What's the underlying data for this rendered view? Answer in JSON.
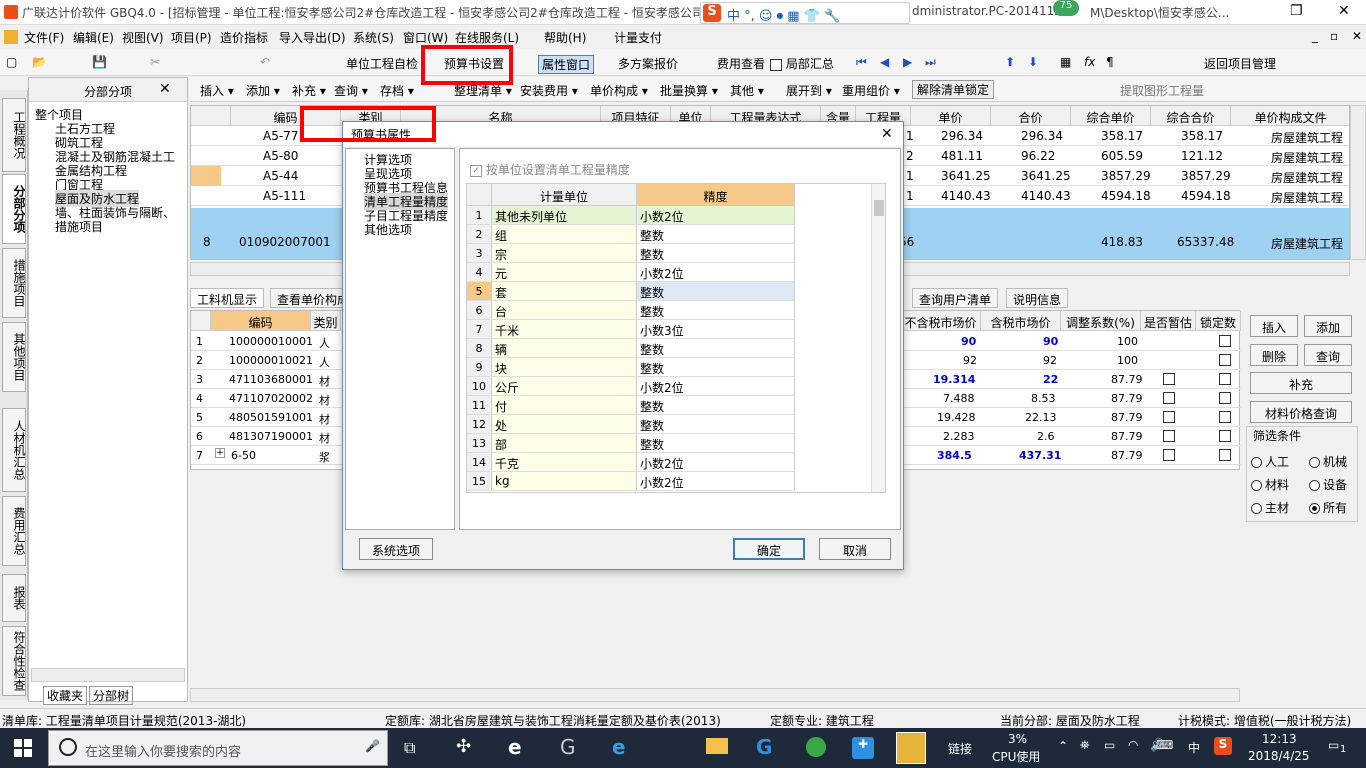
{
  "app": {
    "title": "广联达计价软件 GBQ4.0 - [招标管理 - 单位工程:恒安孝感公司2#仓库改造工程 - 恒安孝感公司2#仓库改造工程 - 恒安孝感公司2",
    "title_right": "dministrator.PC-2014112",
    "title_path": "M\\Desktop\\恒安孝感公...",
    "badge": "75",
    "ime_label": "中 °, ☺ ⏺ ▦ 👕 🔧"
  },
  "menu": [
    "文件(F)",
    "编辑(E)",
    "视图(V)",
    "项目(P)",
    "造价指标",
    "导入导出(D)",
    "系统(S)",
    "窗口(W)",
    "在线服务(L)",
    "帮助(H)",
    "计量支付"
  ],
  "toolbar1": {
    "self_check": "单位工程自检",
    "budget_settings": "预算书设置",
    "property_window": "属性窗口",
    "multi_plan": "多方案报价",
    "fee_view": "费用查看",
    "partial_sum": "局部汇总",
    "return": "返回项目管理"
  },
  "toolbar2": [
    "插入 ▾",
    "添加 ▾",
    "补充 ▾",
    "查询 ▾",
    "存档 ▾",
    "整理清单 ▾",
    "安装费用 ▾",
    "单价构成 ▾",
    "批量换算 ▾",
    "其他 ▾",
    "展开到 ▾",
    "重用组价 ▾",
    "解除清单锁定",
    "提取图形工程量"
  ],
  "left_panel": {
    "header": "分部分项",
    "close": "✕",
    "tree": [
      "整个项目",
      "土石方工程",
      "砌筑工程",
      "混凝土及钢筋混凝土工",
      "金属结构工程",
      "门窗工程",
      "屋面及防水工程",
      "墙、柱面装饰与隔断、",
      "措施项目"
    ],
    "bottom_tabs": [
      "收藏夹",
      "分部树"
    ]
  },
  "side_tabs": [
    "工程概况",
    "分部分项",
    "措施项目",
    "其他项目",
    "人材机汇总",
    "费用汇总",
    "报表",
    "符合性检查"
  ],
  "grid1": {
    "headers": [
      "编码",
      "类别",
      "名称",
      "项目特征",
      "单位",
      "工程量表达式",
      "含量",
      "工程量",
      "单价",
      "合价",
      "综合单价",
      "综合合价",
      "单价构成文件"
    ],
    "rows": [
      {
        "code": "A5-77",
        "qty": "1",
        "price": "296.34",
        "total": "296.34",
        "uprice": "358.17",
        "utotal": "358.17",
        "file": "房屋建筑工程"
      },
      {
        "code": "A5-80",
        "qty": "2",
        "price": "481.11",
        "total": "96.22",
        "uprice": "605.59",
        "utotal": "121.12",
        "file": "房屋建筑工程"
      },
      {
        "code": "A5-44",
        "qty": "1",
        "price": "3641.25",
        "total": "3641.25",
        "uprice": "3857.29",
        "utotal": "3857.29",
        "file": "房屋建筑工程"
      },
      {
        "code": "A5-111",
        "qty": "1",
        "price": "4140.43",
        "total": "4140.43",
        "uprice": "4594.18",
        "utotal": "4594.18",
        "file": "房屋建筑工程"
      },
      {
        "num": "8",
        "code": "010902007001",
        "qty": "56",
        "price": "",
        "total": "",
        "uprice": "418.83",
        "utotal": "65337.48",
        "file": "房屋建筑工程"
      }
    ]
  },
  "lower_tabs": [
    "工料机显示",
    "查看单价构成",
    "查询用户清单",
    "说明信息"
  ],
  "grid2": {
    "headers": [
      "编码",
      "类别",
      "不含税市场价",
      "含税市场价",
      "调整系数(%)",
      "是否暂估",
      "锁定数"
    ],
    "rows": [
      {
        "n": "1",
        "code": "100000010001",
        "type": "人",
        "p1": "90",
        "p2": "90",
        "adj": "100"
      },
      {
        "n": "2",
        "code": "100000010021",
        "type": "人",
        "p1": "92",
        "p2": "92",
        "adj": "100"
      },
      {
        "n": "3",
        "code": "471103680001",
        "type": "材",
        "p1": "19.314",
        "p2": "22",
        "adj": "87.79"
      },
      {
        "n": "4",
        "code": "471107020002",
        "type": "材",
        "p1": "7.488",
        "p2": "8.53",
        "adj": "87.79"
      },
      {
        "n": "5",
        "code": "480501591001",
        "type": "材",
        "p1": "19.428",
        "p2": "22.13",
        "adj": "87.79"
      },
      {
        "n": "6",
        "code": "481307190001",
        "type": "材",
        "p1": "2.283",
        "p2": "2.6",
        "adj": "87.79"
      },
      {
        "n": "7",
        "code": "6-50",
        "type": "浆",
        "p1": "384.5",
        "p2": "437.31",
        "adj": "87.79"
      }
    ]
  },
  "right_buttons": {
    "insert": "插入",
    "add": "添加",
    "delete": "删除",
    "query": "查询",
    "supplement": "补充",
    "price_query": "材料价格查询",
    "filter_label": "筛选条件"
  },
  "filters": [
    "人工",
    "机械",
    "材料",
    "设备",
    "主材",
    "所有"
  ],
  "dialog": {
    "title": "预算书属性",
    "close": "✕",
    "nav": [
      "计算选项",
      "呈现选项",
      "预算书工程信息",
      "清单工程量精度",
      "子目工程量精度",
      "其他选项"
    ],
    "selected_nav": "清单工程量精度",
    "checkbox_label": "按单位设置清单工程量精度",
    "col_unit": "计量单位",
    "col_precision": "精度",
    "rows": [
      {
        "n": "1",
        "unit": "其他未列单位",
        "p": "小数2位"
      },
      {
        "n": "2",
        "unit": "组",
        "p": "整数"
      },
      {
        "n": "3",
        "unit": "宗",
        "p": "整数"
      },
      {
        "n": "4",
        "unit": "元",
        "p": "小数2位"
      },
      {
        "n": "5",
        "unit": "套",
        "p": "整数"
      },
      {
        "n": "6",
        "unit": "台",
        "p": "整数"
      },
      {
        "n": "7",
        "unit": "千米",
        "p": "小数3位"
      },
      {
        "n": "8",
        "unit": "辆",
        "p": "整数"
      },
      {
        "n": "9",
        "unit": "块",
        "p": "整数"
      },
      {
        "n": "10",
        "unit": "公斤",
        "p": "小数2位"
      },
      {
        "n": "11",
        "unit": "付",
        "p": "整数"
      },
      {
        "n": "12",
        "unit": "处",
        "p": "整数"
      },
      {
        "n": "13",
        "unit": "部",
        "p": "整数"
      },
      {
        "n": "14",
        "unit": "千克",
        "p": "小数2位"
      },
      {
        "n": "15",
        "unit": "kg",
        "p": "小数2位"
      }
    ],
    "system_options": "系统选项",
    "ok": "确定",
    "cancel": "取消"
  },
  "statusbar": {
    "list_lib": "清单库: 工程量清单项目计量规范(2013-湖北)",
    "quota_lib": "定额库: 湖北省房屋建筑与装饰工程消耗量定额及基价表(2013)",
    "major": "定额专业: 建筑工程",
    "current": "当前分部: 屋面及防水工程",
    "tax": "计税模式: 增值税(一般计税方法)"
  },
  "taskbar": {
    "search_placeholder": "在这里输入你要搜索的内容",
    "link": "链接",
    "cpu": "3%",
    "cpu_label": "CPU使用",
    "lang": "中",
    "time": "12:13",
    "date": "2018/4/25",
    "notify": "1"
  }
}
